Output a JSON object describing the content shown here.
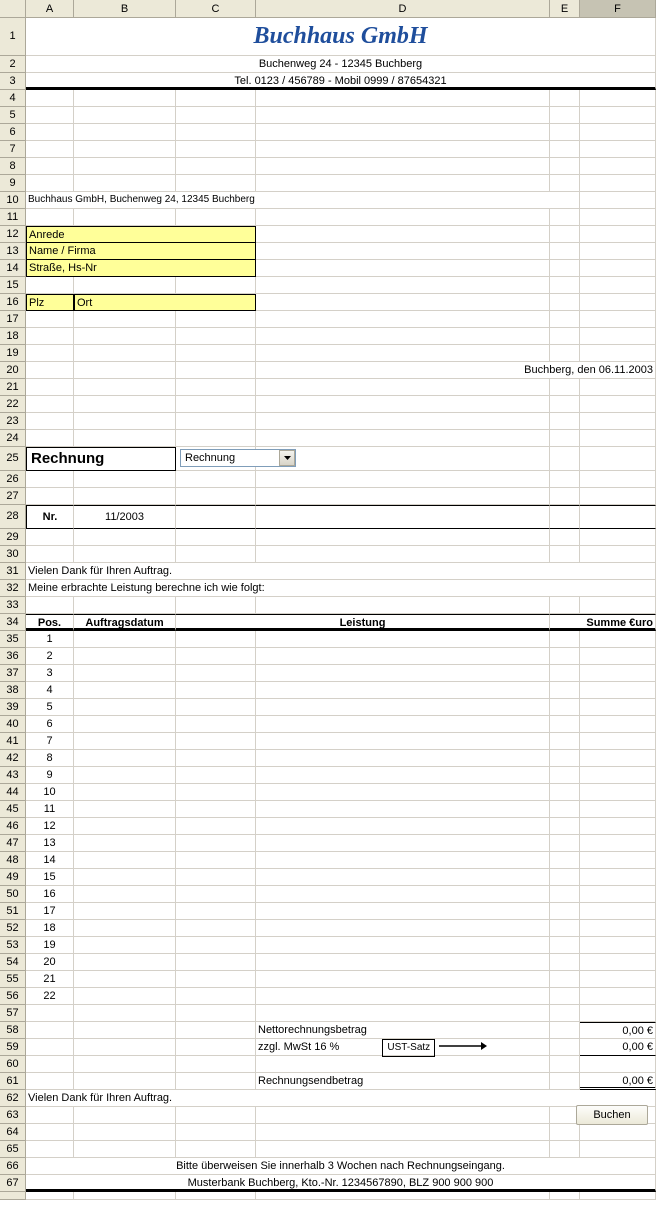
{
  "columns": [
    "A",
    "B",
    "C",
    "D",
    "E",
    "F"
  ],
  "company": {
    "name": "Buchhaus GmbH",
    "address": "Buchenweg 24 - 12345 Buchberg",
    "phone": "Tel. 0123 / 456789 - Mobil 0999 / 87654321",
    "sender": "Buchhaus GmbH, Buchenweg 24, 12345 Buchberg"
  },
  "recipient": {
    "anrede": "Anrede",
    "name": "Name / Firma",
    "street": "Straße, Hs-Nr",
    "plz": "Plz",
    "ort": "Ort"
  },
  "date_line": "Buchberg, den 06.11.2003",
  "doc": {
    "label": "Rechnung",
    "dropdown_value": "Rechnung",
    "nr_label": "Nr.",
    "nr_value": "11/2003"
  },
  "body": {
    "thanks1": "Vielen Dank für Ihren Auftrag.",
    "line2": "Meine erbrachte Leistung berechne ich wie folgt:"
  },
  "table": {
    "headers": {
      "pos": "Pos.",
      "datum": "Auftragsdatum",
      "leistung": "Leistung",
      "summe": "Summe €uro"
    },
    "rows": [
      1,
      2,
      3,
      4,
      5,
      6,
      7,
      8,
      9,
      10,
      11,
      12,
      13,
      14,
      15,
      16,
      17,
      18,
      19,
      20,
      21,
      22
    ]
  },
  "totals": {
    "netto_label": "Nettorechnungsbetrag",
    "netto_value": "0,00 €",
    "mwst_label": "zzgl. MwSt 16 %",
    "ust_box": "UST-Satz",
    "mwst_value": "0,00 €",
    "end_label": "Rechnungsendbetrag",
    "end_value": "0,00 €"
  },
  "footer": {
    "thanks": "Vielen Dank für Ihren Auftrag.",
    "pay": "Bitte überweisen Sie innerhalb 3 Wochen nach Rechnungseingang.",
    "bank": "Musterbank Buchberg, Kto.-Nr. 1234567890, BLZ 900 900 900"
  },
  "button": "Buchen"
}
